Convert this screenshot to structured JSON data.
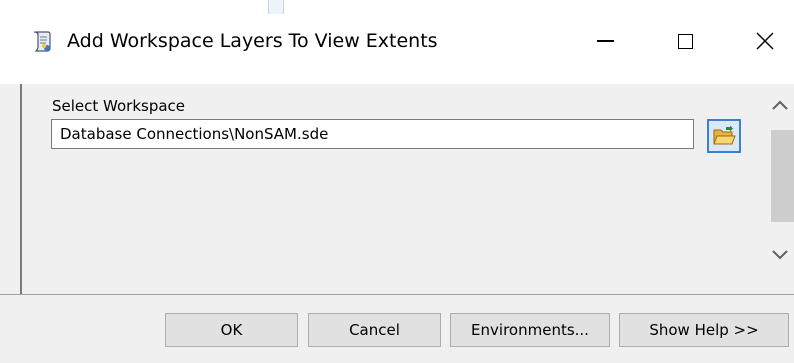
{
  "window": {
    "title": "Add Workspace Layers To View Extents",
    "app_icon": "python-script-icon"
  },
  "form": {
    "workspace_label": "Select Workspace",
    "workspace_value": "Database Connections\\NonSAM.sde",
    "browse_icon": "open-folder-icon"
  },
  "buttons": {
    "ok": "OK",
    "cancel": "Cancel",
    "environments": "Environments...",
    "show_help": "Show Help >>"
  },
  "colors": {
    "accent": "#3c7fd6",
    "background": "#f0f0f0",
    "titlebar": "#ffffff"
  }
}
